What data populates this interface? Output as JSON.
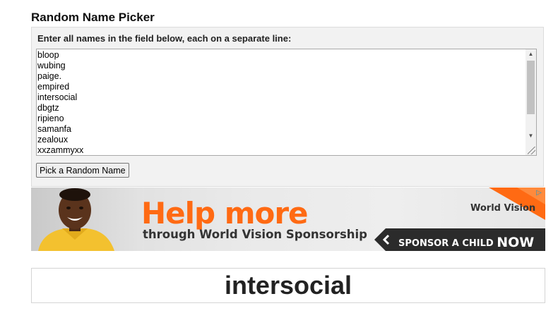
{
  "page": {
    "title": "Random Name Picker",
    "instructions": "Enter all names in the field below, each on a separate line:"
  },
  "names": [
    "bloop",
    "wubing",
    "paige.",
    "empired",
    "intersocial",
    "dbgtz",
    "ripieno",
    "samanfa",
    "zealoux",
    "xxzammyxx"
  ],
  "button": {
    "label": "Pick a Random Name"
  },
  "ad": {
    "headline": "Help more",
    "subline": "through World Vision Sponsorship",
    "brand": "World Vision",
    "cta": "SPONSOR A CHILD",
    "cta_emphasis": "NOW",
    "colors": {
      "accent": "#ff6a13",
      "cta_bg": "#2b2b2b",
      "text": "#333333"
    }
  },
  "result": {
    "name": "intersocial"
  },
  "icons": {
    "scroll_up": "▲",
    "scroll_down": "▼",
    "ad_choices": "▷",
    "cta_chevron": "chevron-left-icon"
  }
}
